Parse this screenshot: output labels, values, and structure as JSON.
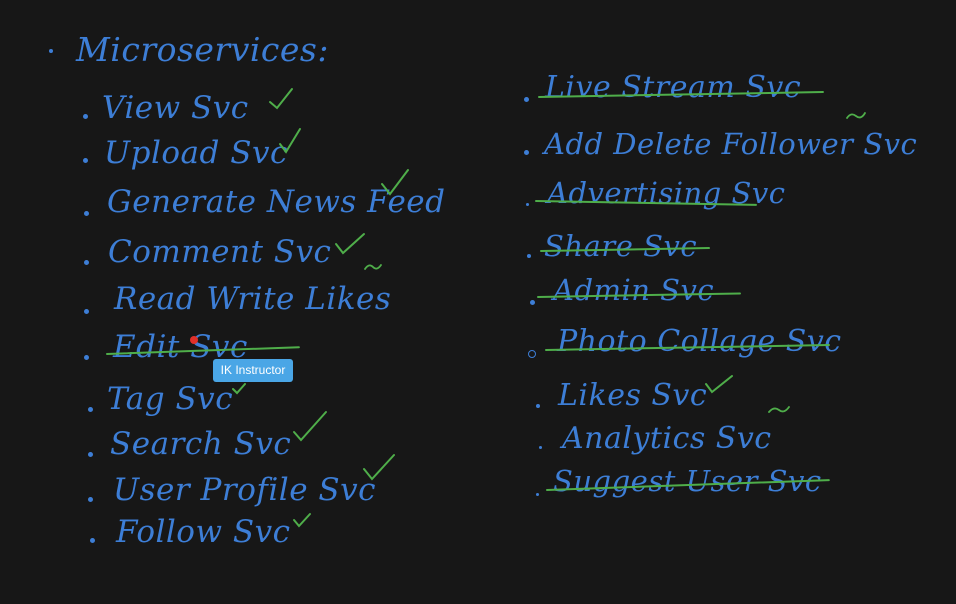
{
  "title": "Microservices:",
  "left_items": [
    {
      "label": "View Svc",
      "status": "check"
    },
    {
      "label": "Upload Svc",
      "status": "check"
    },
    {
      "label": "Generate News Feed",
      "status": "check"
    },
    {
      "label": "Comment Svc",
      "status": "check"
    },
    {
      "label": "Read Write Likes",
      "status": "none"
    },
    {
      "label": "Edit Svc",
      "status": "struck"
    },
    {
      "label": "Tag Svc",
      "status": "check"
    },
    {
      "label": "Search Svc",
      "status": "check"
    },
    {
      "label": "User Profile Svc",
      "status": "check"
    },
    {
      "label": "Follow Svc",
      "status": "check"
    }
  ],
  "right_items": [
    {
      "label": "Live Stream Svc",
      "status": "struck"
    },
    {
      "label": "Add Delete Follower Svc",
      "status": "tilde"
    },
    {
      "label": "Advertising Svc",
      "status": "struck"
    },
    {
      "label": "Share Svc",
      "status": "struck"
    },
    {
      "label": "Admin Svc",
      "status": "struck"
    },
    {
      "label": "Photo Collage Svc",
      "status": "struck"
    },
    {
      "label": "Likes Svc",
      "status": "check"
    },
    {
      "label": "Analytics Svc",
      "status": "tilde"
    },
    {
      "label": "Suggest User Svc",
      "status": "struck"
    }
  ],
  "pointer_tag": "IK Instructor",
  "colors": {
    "background": "#171717",
    "ink": "#3d7ed6",
    "mark": "#4fae4a",
    "tag": "#4aa6e6",
    "pointer": "#e0302a"
  }
}
